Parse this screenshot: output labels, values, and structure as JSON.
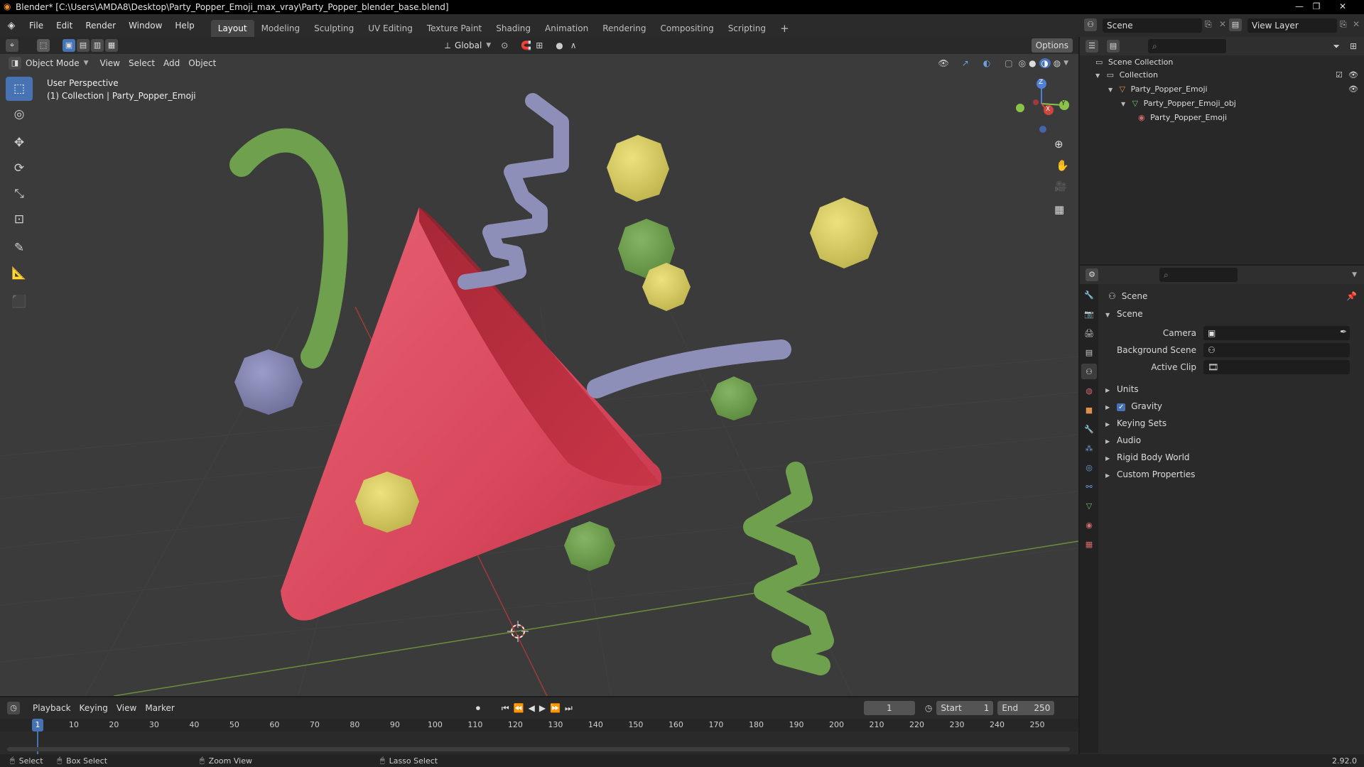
{
  "window": {
    "title": "Blender* [C:\\Users\\AMDA8\\Desktop\\Party_Popper_Emoji_max_vray\\Party_Popper_blender_base.blend]"
  },
  "menubar": {
    "menus": [
      "File",
      "Edit",
      "Render",
      "Window",
      "Help"
    ],
    "workspaces": [
      "Layout",
      "Modeling",
      "Sculpting",
      "UV Editing",
      "Texture Paint",
      "Shading",
      "Animation",
      "Rendering",
      "Compositing",
      "Scripting"
    ],
    "active_workspace": "Layout",
    "add_tab": "+"
  },
  "topright": {
    "scene_label": "Scene",
    "view_layer_label": "View Layer"
  },
  "viewport": {
    "transform_orientation": "Global",
    "options_label": "Options",
    "mode": "Object Mode",
    "menus": [
      "View",
      "Select",
      "Add",
      "Object"
    ],
    "info_line1": "User Perspective",
    "info_line2": "(1) Collection | Party_Popper_Emoji",
    "gizmo": {
      "x": "X",
      "y": "Y",
      "z": "Z"
    }
  },
  "outliner": {
    "items": [
      {
        "label": "Scene Collection"
      },
      {
        "label": "Collection"
      },
      {
        "label": "Party_Popper_Emoji"
      },
      {
        "label": "Party_Popper_Emoji_obj"
      },
      {
        "label": "Party_Popper_Emoji"
      }
    ]
  },
  "properties": {
    "header": "Scene",
    "section": "Scene",
    "fields": [
      {
        "label": "Camera"
      },
      {
        "label": "Background Scene"
      },
      {
        "label": "Active Clip"
      }
    ],
    "panels": [
      "Units",
      "Gravity",
      "Keying Sets",
      "Audio",
      "Rigid Body World",
      "Custom Properties"
    ],
    "gravity_checked": true
  },
  "timeline": {
    "menus": [
      "Playback",
      "Keying",
      "View",
      "Marker"
    ],
    "current_frame": "1",
    "start_label": "Start",
    "start_value": "1",
    "end_label": "End",
    "end_value": "250",
    "ticks": [
      "1",
      "10",
      "20",
      "30",
      "40",
      "50",
      "60",
      "70",
      "80",
      "90",
      "100",
      "110",
      "120",
      "130",
      "140",
      "150",
      "160",
      "170",
      "180",
      "190",
      "200",
      "210",
      "220",
      "230",
      "240",
      "250"
    ]
  },
  "statusbar": {
    "select": "Select",
    "box_select": "Box Select",
    "zoom_view": "Zoom View",
    "lasso_select": "Lasso Select",
    "version": "2.92.0"
  },
  "colors": {
    "accent": "#4772b3",
    "cone": "#d94a5e",
    "green": "#6fa04d",
    "yellow": "#d8cc62",
    "lavender": "#8d8fb8"
  }
}
